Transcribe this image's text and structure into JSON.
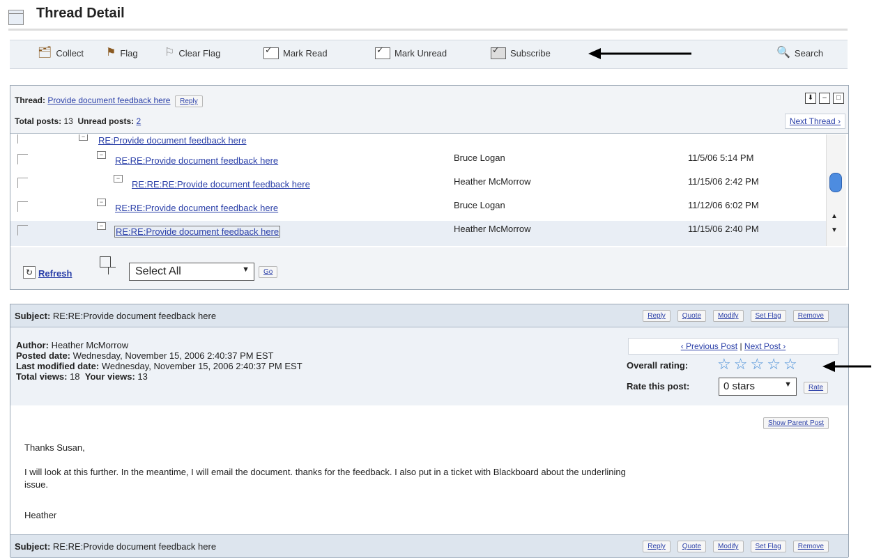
{
  "header": {
    "title": "Thread Detail"
  },
  "toolbar": {
    "collect": "Collect",
    "flag": "Flag",
    "clear_flag": "Clear Flag",
    "mark_read": "Mark Read",
    "mark_unread": "Mark Unread",
    "subscribe": "Subscribe",
    "search": "Search"
  },
  "thread": {
    "thread_label": "Thread:",
    "thread_link": "Provide document feedback here",
    "reply": "Reply",
    "total_label": "Total posts:",
    "total_value": "13",
    "unread_label": "Unread posts:",
    "unread_value": "2",
    "next_thread": "Next Thread ›",
    "rows": [
      {
        "subject": "RE:Provide document feedback here",
        "author": "",
        "date": ""
      },
      {
        "subject": "RE:RE:Provide document feedback here",
        "author": "Bruce Logan",
        "date": "11/5/06 5:14 PM"
      },
      {
        "subject": "RE:RE:RE:Provide document feedback here",
        "author": "Heather McMorrow",
        "date": "11/15/06 2:42 PM"
      },
      {
        "subject": "RE:RE:Provide document feedback here",
        "author": "Bruce Logan",
        "date": "11/12/06 6:02 PM"
      },
      {
        "subject": "RE:RE:Provide document feedback here",
        "author": "Heather McMorrow",
        "date": "11/15/06 2:40 PM"
      }
    ],
    "refresh": "Refresh",
    "select_all": "Select All",
    "go": "Go"
  },
  "post": {
    "subject_label": "Subject:",
    "subject": "RE:RE:Provide document feedback here",
    "actions": {
      "reply": "Reply",
      "quote": "Quote",
      "modify": "Modify",
      "set_flag": "Set Flag",
      "remove": "Remove"
    },
    "author_label": "Author:",
    "author": "Heather McMorrow",
    "posted_label": "Posted date:",
    "posted": "Wednesday, November 15, 2006 2:40:37 PM EST",
    "modified_label": "Last modified date:",
    "modified": "Wednesday, November 15, 2006 2:40:37 PM EST",
    "views_label": "Total views:",
    "views": "18",
    "your_views_label": "Your views:",
    "your_views": "13",
    "prev_post": "‹ Previous Post",
    "next_post": "Next Post ›",
    "sep": "|",
    "rating_label": "Overall rating:",
    "rating_value": 0,
    "rate_label": "Rate this post:",
    "rate_select": "0 stars",
    "rate_button": "Rate",
    "show_parent": "Show Parent Post",
    "body": {
      "greeting": "Thanks Susan,",
      "para1": "I will look at this further. In the meantime, I will email the document. thanks for the feedback. I also put in a ticket with Blackboard about the underlining",
      "para1b": "issue.",
      "signoff": "Heather"
    },
    "next_subject_label": "Subject:",
    "next_subject": "RE:RE:Provide document feedback here"
  }
}
